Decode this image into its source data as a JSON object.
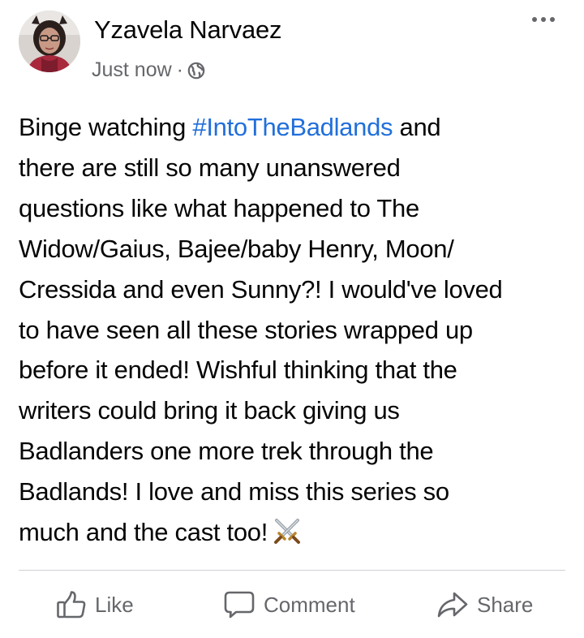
{
  "post": {
    "author": "Yzavela Narvaez",
    "timestamp": "Just now",
    "separator": "·",
    "audience_icon": "globe-icon",
    "more_icon": "more-options-icon",
    "text": {
      "lines": [
        {
          "before": "Binge watching ",
          "hashtag": "#IntoTheBadlands",
          "after": " and"
        },
        {
          "text": "there are still so many unanswered"
        },
        {
          "text": "questions like what happened to The"
        },
        {
          "text": "Widow/Gaius, Bajee/baby Henry, Moon/"
        },
        {
          "text": "Cressida and even Sunny?! I would've loved"
        },
        {
          "text": "to have seen all these stories wrapped up"
        },
        {
          "text": "before it ended! Wishful thinking that the"
        },
        {
          "text": "writers could bring it back giving us"
        },
        {
          "text": "Badlanders one more trek through the"
        },
        {
          "text": "Badlands! I love and miss this series so"
        },
        {
          "text": "much and the cast too!"
        }
      ],
      "emoji": "crossed-swords-emoji"
    }
  },
  "actions": {
    "like": {
      "label": "Like",
      "icon": "thumbs-up-icon"
    },
    "comment": {
      "label": "Comment",
      "icon": "comment-bubble-icon"
    },
    "share": {
      "label": "Share",
      "icon": "share-arrow-icon"
    }
  },
  "colors": {
    "text": "#050505",
    "secondary_text": "#65676b",
    "hashtag": "#216fdb",
    "divider": "#ced0d4"
  }
}
